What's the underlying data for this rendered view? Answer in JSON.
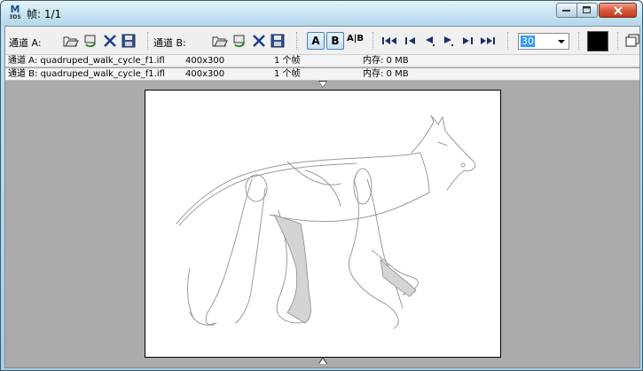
{
  "window": {
    "title": "帧: 1/1",
    "app_icon_letter": "M",
    "app_icon_sub": "3DS"
  },
  "toolbar": {
    "channel_a_label": "通道 A:",
    "channel_b_label": "通道 B:",
    "ab_a_label": "A",
    "ab_b_label": "B",
    "ab_split_label": "A|B",
    "frame_value": "30",
    "swatch_color": "#000000"
  },
  "info": {
    "rows": [
      {
        "file": "通道 A: quadruped_walk_cycle_f1.ifl",
        "size": "400x300",
        "frames": "1 个帧",
        "memory": "内存: 0 MB"
      },
      {
        "file": "通道 B: quadruped_walk_cycle_f1.ifl",
        "size": "400x300",
        "frames": "1 个帧",
        "memory": "内存: 0 MB"
      }
    ]
  },
  "colors": {
    "client_bg": "#ababab",
    "accent": "#3399ff",
    "close_red": "#c0391c"
  }
}
